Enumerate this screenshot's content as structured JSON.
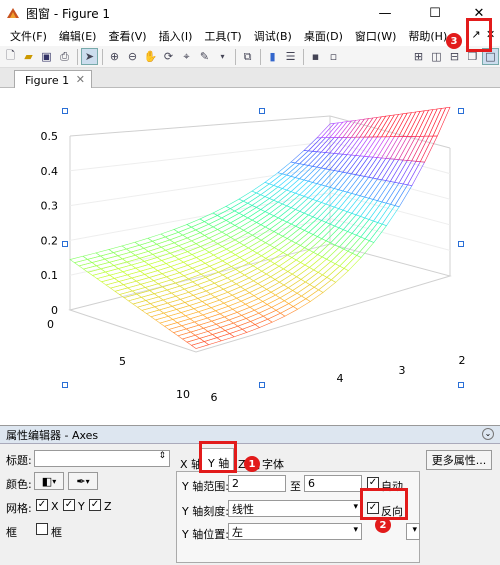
{
  "window": {
    "title": "图窗 - Figure 1"
  },
  "menu": [
    "文件(F)",
    "编辑(E)",
    "查看(V)",
    "插入(I)",
    "工具(T)",
    "调试(B)",
    "桌面(D)",
    "窗口(W)",
    "帮助(H)"
  ],
  "tab": {
    "label": "Figure 1"
  },
  "plot": {
    "z_ticks": [
      "0",
      "0.1",
      "0.2",
      "0.3",
      "0.4",
      "0.5"
    ],
    "y_ticks": [
      "0",
      "5",
      "10"
    ],
    "x_ticks": [
      "6",
      "4",
      "3",
      "2"
    ]
  },
  "property_editor": {
    "title": "属性编辑器 - Axes",
    "title_label": "标题:",
    "color_label": "颜色:",
    "grid_label": "网格:",
    "grid_x": "X",
    "grid_y": "Y",
    "grid_z": "Z",
    "box_label": "框",
    "box_check_label": "框",
    "tabs": [
      "X 轴",
      "Y 轴",
      "Z 轴",
      "字体"
    ],
    "more_props": "更多属性...",
    "y_range_label": "Y 轴范围:",
    "y_min": "2",
    "to_label": "至",
    "y_max": "6",
    "auto_label": "自动",
    "y_scale_label": "Y 轴刻度:",
    "y_scale_value": "线性",
    "reverse_label": "反向",
    "y_location_label": "Y 轴位置:",
    "y_location_value": "左"
  },
  "annotations": [
    "1",
    "2",
    "3"
  ]
}
